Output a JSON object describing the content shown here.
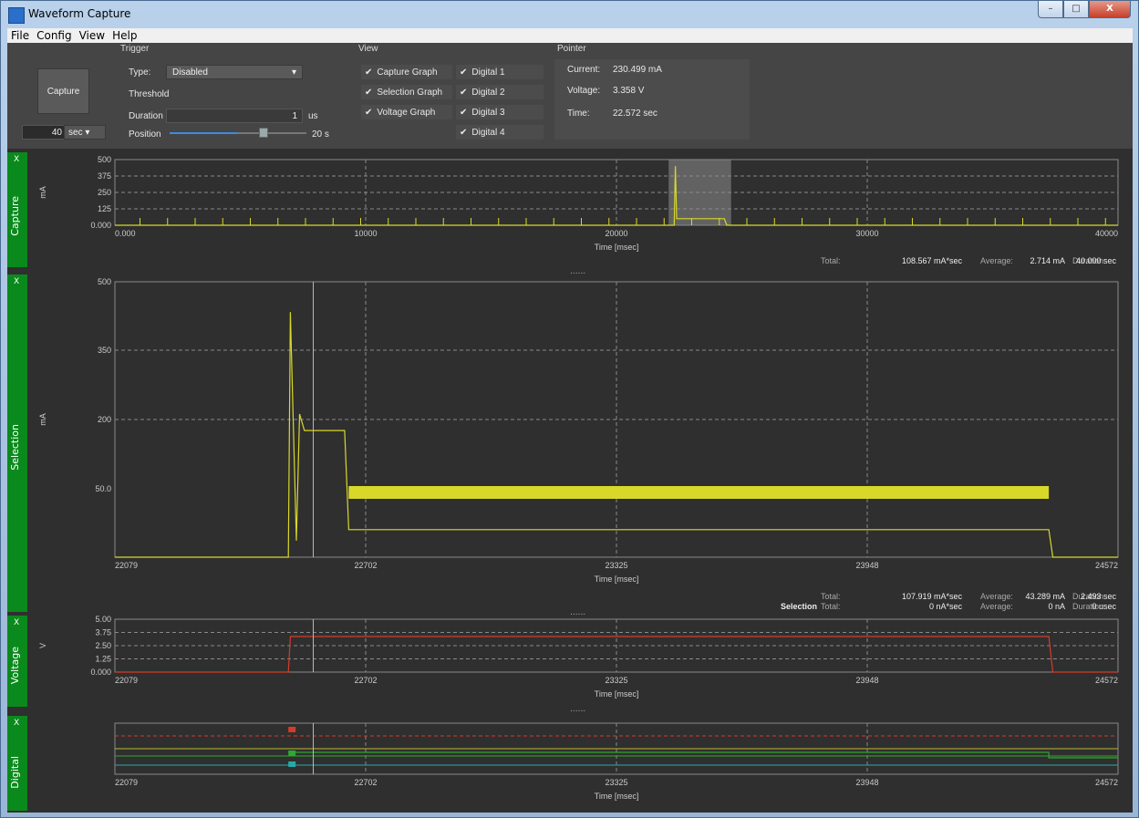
{
  "window": {
    "title": "Waveform Capture",
    "min": "–",
    "max": "□",
    "close": "X"
  },
  "menu": [
    "File",
    "Config",
    "View",
    "Help"
  ],
  "trigger": {
    "group": "Trigger",
    "capture_label": "Capture",
    "duration_value": "40",
    "duration_unit": "sec",
    "type_label": "Type:",
    "type_value": "Disabled",
    "threshold_label": "Threshold",
    "duration_label": "Duration",
    "duration_input": "1",
    "duration_input_unit": "us",
    "position_label": "Position",
    "position_value": "20 s",
    "position_fraction": 0.5
  },
  "view": {
    "group": "View",
    "check_mark": "✔",
    "checks_left": [
      "Capture Graph",
      "Selection Graph",
      "Voltage Graph"
    ],
    "checks_right": [
      "Digital 1",
      "Digital 2",
      "Digital 3",
      "Digital 4"
    ]
  },
  "pointer": {
    "group": "Pointer",
    "current_label": "Current:",
    "current": "230.499 mA",
    "voltage_label": "Voltage:",
    "voltage": "3.358 V",
    "time_label": "Time:",
    "time": "22.572 sec"
  },
  "capture_panel": {
    "close": "X",
    "name": "Capture",
    "unit": "mA",
    "xlabel": "Time [msec]",
    "yticks": [
      "500",
      "375",
      "250",
      "125",
      "0.000"
    ],
    "xticks": [
      "0.000",
      "10000",
      "20000",
      "30000",
      "40000"
    ],
    "stats": {
      "total_label": "Total:",
      "total": "108.567 mA*sec",
      "avg_label": "Average:",
      "avg": "2.714 mA",
      "dur_label": "Duration:",
      "dur": "40.000 sec"
    }
  },
  "selection_panel": {
    "close": "X",
    "name": "Selection",
    "unit": "mA",
    "xlabel": "Time [msec]",
    "yticks": [
      "500",
      "350",
      "200",
      "50.0"
    ],
    "xticks": [
      "22079",
      "22702",
      "23325",
      "23948",
      "24572"
    ],
    "stats": {
      "total_label": "Total:",
      "total": "107.919 mA*sec",
      "avg_label": "Average:",
      "avg": "43.289 mA",
      "dur_label": "Duration:",
      "dur": "2.493 sec"
    },
    "sel_stats": {
      "title": "Selection",
      "total_label": "Total:",
      "total": "0 nA*sec",
      "avg_label": "Average:",
      "avg": "0 nA",
      "dur_label": "Duration:",
      "dur": "0 usec"
    }
  },
  "voltage_panel": {
    "close": "X",
    "name": "Voltage",
    "unit": "V",
    "xlabel": "Time [msec]",
    "yticks": [
      "5.00",
      "3.75",
      "2.50",
      "1.25",
      "0.000"
    ],
    "xticks": [
      "22079",
      "22702",
      "23325",
      "23948",
      "24572"
    ]
  },
  "digital_panel": {
    "close": "X",
    "name": "Digital",
    "xlabel": "Time [msec]",
    "xticks": [
      "22079",
      "22702",
      "23325",
      "23948",
      "24572"
    ]
  },
  "splitter": "......",
  "colors": {
    "trace": "#d8d82a",
    "voltage": "#d83a2a",
    "grid": "#8a8a8a",
    "green": "#0a8a1c"
  },
  "chart_data": [
    {
      "type": "line",
      "title": "Capture",
      "xlabel": "Time [msec]",
      "ylabel": "mA",
      "xlim": [
        0,
        40000
      ],
      "ylim": [
        0,
        500
      ],
      "series": [
        {
          "x": [
            0,
            22300,
            22350,
            22400,
            24300,
            24400,
            40000
          ],
          "y": [
            0,
            0,
            450,
            50,
            50,
            0,
            0
          ]
        }
      ]
    },
    {
      "type": "line",
      "title": "Selection",
      "xlabel": "Time [msec]",
      "ylabel": "mA",
      "xlim": [
        22079,
        24572
      ],
      "ylim": [
        0,
        500
      ],
      "series": [
        {
          "x": [
            22079,
            22510,
            22515,
            22530,
            22538,
            22550,
            22650,
            22660,
            24400,
            24410,
            24572
          ],
          "y": [
            0,
            0,
            445,
            30,
            260,
            230,
            230,
            50,
            50,
            0,
            0
          ]
        }
      ]
    },
    {
      "type": "line",
      "title": "Voltage",
      "xlabel": "Time [msec]",
      "ylabel": "V",
      "xlim": [
        22079,
        24572
      ],
      "ylim": [
        0,
        5
      ],
      "series": [
        {
          "x": [
            22079,
            22510,
            22515,
            24400,
            24410,
            24572
          ],
          "y": [
            0,
            0,
            3.358,
            3.358,
            0,
            0
          ]
        }
      ]
    }
  ]
}
